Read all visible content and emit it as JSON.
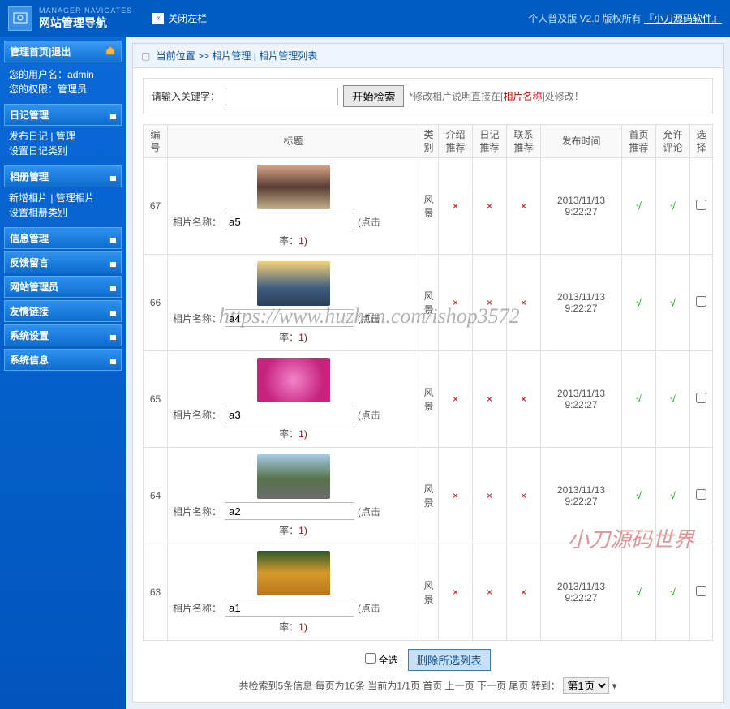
{
  "header": {
    "logo_sub": "MANAGER NAVIGATES",
    "logo_main": "网站管理导航",
    "close_left": "关闭左栏",
    "top_right_prefix": "个人普及版  V2.0  版权所有",
    "top_right_brand": "『小刀源码软件』"
  },
  "sidebar": {
    "home": "管理首页",
    "sep": " | ",
    "logout": "退出",
    "user_label": "您的用户名：",
    "user": "admin",
    "role_label": "您的权限：",
    "role": "管理员",
    "cats": [
      {
        "label": "日记管理",
        "subs": [
          "发布日记 | 管理",
          "设置日记类别"
        ]
      },
      {
        "label": "相册管理",
        "subs": [
          "新增相片 | 管理相片",
          "设置相册类别"
        ]
      },
      {
        "label": "信息管理",
        "subs": []
      },
      {
        "label": "反馈留言",
        "subs": []
      },
      {
        "label": "网站管理员",
        "subs": []
      },
      {
        "label": "友情链接",
        "subs": []
      },
      {
        "label": "系统设置",
        "subs": []
      },
      {
        "label": "系统信息",
        "subs": []
      }
    ]
  },
  "breadcrumb": {
    "prefix": "当前位置 >> ",
    "section": "相片管理",
    "sep": " | ",
    "page": "相片管理列表"
  },
  "search": {
    "label": "请输入关键字：",
    "button": "开始检索",
    "hint_pre": "*修改相片说明直接在[",
    "hint_key": "相片名称",
    "hint_post": "]处修改！"
  },
  "table": {
    "headers": {
      "id": "编号",
      "title": "标题",
      "category": "类别",
      "intro_rec": "介绍推荐",
      "diary_rec": "日记推荐",
      "contact_rec": "联系推荐",
      "pub_time": "发布时间",
      "home_rec": "首页推荐",
      "allow_cmt": "允许评论",
      "select": "选择"
    },
    "name_label": "相片名称：",
    "click_label": "(点击",
    "rate_label": "率：",
    "rate_val": "1)",
    "rows": [
      {
        "id": "67",
        "name": "a5",
        "category": "风景",
        "intro": "×",
        "diary": "×",
        "contact": "×",
        "time": "2013/11/13 9:22:27",
        "home": "√",
        "allow": "√"
      },
      {
        "id": "66",
        "name": "a4",
        "category": "风景",
        "intro": "×",
        "diary": "×",
        "contact": "×",
        "time": "2013/11/13 9:22:27",
        "home": "√",
        "allow": "√"
      },
      {
        "id": "65",
        "name": "a3",
        "category": "风景",
        "intro": "×",
        "diary": "×",
        "contact": "×",
        "time": "2013/11/13 9:22:27",
        "home": "√",
        "allow": "√"
      },
      {
        "id": "64",
        "name": "a2",
        "category": "风景",
        "intro": "×",
        "diary": "×",
        "contact": "×",
        "time": "2013/11/13 9:22:27",
        "home": "√",
        "allow": "√"
      },
      {
        "id": "63",
        "name": "a1",
        "category": "风景",
        "intro": "×",
        "diary": "×",
        "contact": "×",
        "time": "2013/11/13 9:22:27",
        "home": "√",
        "allow": "√"
      }
    ]
  },
  "footer": {
    "select_all": "全选",
    "delete": "删除所选列表"
  },
  "pager": {
    "text_pre": "共检索到",
    "total": "5",
    "text_mid": "条信息  每页为",
    "per": "16",
    "text_mid2": "条  当前为",
    "page_cur": "1/1",
    "text_mid3": "页 ",
    "first": "首页",
    "prev": "上一页",
    "next": "下一页",
    "last": "尾页",
    "goto": "  转到：",
    "select_opt": "第1页"
  },
  "watermark": {
    "w1": "https://www.huzhan.com/ishop3572",
    "w2": "小刀源码世界"
  }
}
